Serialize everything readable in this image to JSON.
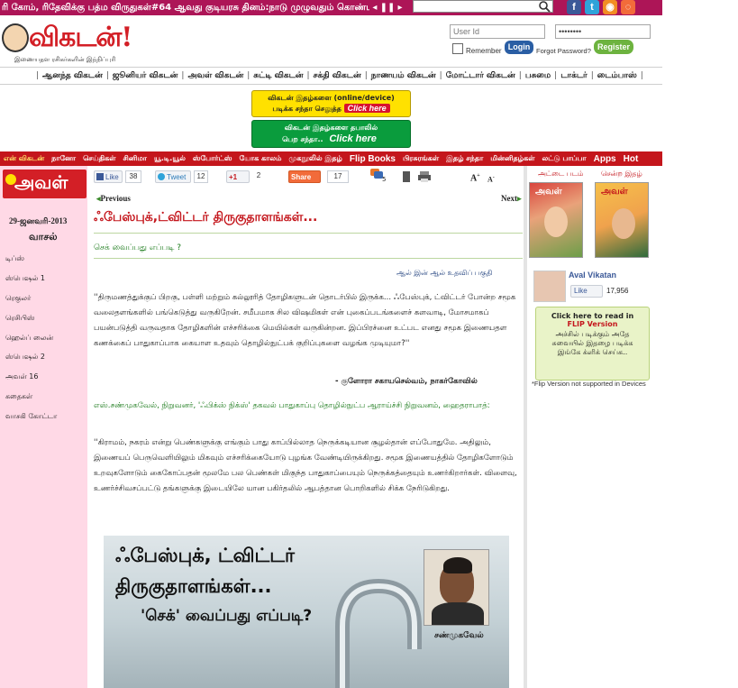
{
  "ticker": {
    "text": "ரி கோம், ரிதேவிக்கு பத்ம விருதுகள்#64 ஆவது குடியரசு தினம்:நாடு முழுவதும் கொண்டாட்டம்#",
    "controls": "◂ ❚❚ ▸"
  },
  "header": {
    "logo_text": "விகடன்!",
    "logo_tagline": "இணையதள ரசிகர்களின் இந்நிப்புரி",
    "userid_placeholder": "User Id",
    "password_value": "••••••••",
    "remember_label": "Remember",
    "login_label": "Login",
    "forgot_label": "Forgot Password?",
    "register_label": "Register"
  },
  "magazine_nav": [
    "ஆனந்த விகடன்",
    "ஜூனியர் விகடன்",
    "அவள் விகடன்",
    "சுட்டி விகடன்",
    "சக்தி விகடன்",
    "நாணயம் விகடன்",
    "மோட்டார் விகடன்",
    "பசுமை",
    "டாக்டர்",
    "டைம்பாஸ்"
  ],
  "banners": {
    "yellow_line1": "விகடன் இதழ்களை (online/device)",
    "yellow_line2": "படிக்க சந்தா செலுத்த",
    "yellow_click": "Click here",
    "green_line1": "விகடன் இதழ்களை தபாலில்",
    "green_line2": "பெற சந்தா..",
    "green_click": "Click here"
  },
  "main_nav": [
    {
      "label": "என் விகடன்",
      "style": "yellow"
    },
    {
      "label": "நானோ",
      "style": ""
    },
    {
      "label": "செய்திகள்",
      "style": ""
    },
    {
      "label": "சினிமா",
      "style": ""
    },
    {
      "label": "யூ.டி.யூல்",
      "style": ""
    },
    {
      "label": "ஸ்போர்ட்ஸ்",
      "style": ""
    },
    {
      "label": "யோக காலம்",
      "style": ""
    },
    {
      "label": "முகநூலில் இதழ்",
      "style": ""
    },
    {
      "label": "Flip Books",
      "style": "big"
    },
    {
      "label": "பிரசுரங்கள்",
      "style": ""
    },
    {
      "label": "இதழ் சந்தா",
      "style": ""
    },
    {
      "label": "மின்னிதழ்கள்",
      "style": ""
    },
    {
      "label": "லட்டு பாப்பா",
      "style": ""
    },
    {
      "label": "Apps",
      "style": "big"
    },
    {
      "label": "Hot",
      "style": "big"
    }
  ],
  "left_sidebar": {
    "logo_text": "அவள்",
    "date": "29-ஜனவரி-2013",
    "section": "வாசல்",
    "items": [
      "டிப்ஸ்",
      "ஸ்பெஷல் 1",
      "ரெகுலர்",
      "ரெசிபிஸ்",
      "ஹெல்ப் லைன்",
      "ஸ்பெஷல் 2",
      "அவள் 16",
      "கதைகள்",
      "வாசகி கோட்டா"
    ]
  },
  "share": {
    "fb_like": "Like",
    "fb_count": "38",
    "tweet": "Tweet",
    "tweet_count": "12",
    "gplus": "+1",
    "gplus_count": "2",
    "share_label": "Share",
    "share_count": "17",
    "comments_count": "5"
  },
  "article": {
    "prev": "Previous",
    "next": "Next",
    "title": "ஃபேஸ்புக்,ட்விட்டர் திருகுதாளங்கள்...",
    "subtitle": "செக் வைப்பது எப்படி ?",
    "section_label": "ஆல் இன் ஆல் உதவிப் பகுதி",
    "quote": "''திருமணத்துக்குப் பிறகு, பள்ளி மற்றும் கல்லூரித் தோழிகளுடன் தொடர்பில் இருக்க... ஃபேஸ்புக், ட்விட்டர் போன்ற சமூக வலைதளங்களில் பங்கெடுத்து வருகிறேன். சமீபமாக சில விஷமிகள் என் புகைப்படங்களைச் களவாடி, மோசமாகப் பயன்படுத்தி வருவதாக தோழிகளின் எச்சரிக்கை மெயில்கள் வருகின்றன. இப்பிரச்னை உட்பட எனது சமூக இணையதள கணக்கைப் பாதுகாப்பாக கையாள உதவும் தொழில்நுட்பக் குறிப்புகளை வழங்க முடியுமா?''",
    "quote_author": "- குளோரா சகாயசெல்வம், நாகர்கோவில்",
    "person_intro": "எஸ்.சண்முகவேல், நிறுவனர், 'ஃபிக்ஸ் நிக்ஸ்' தகவல் பாதுகாப்பு தொழில்நுட்ப ஆராய்ச்சி நிறுவனம், ஹைதராபாத்:",
    "para2": "''கிராமம், நகரம் என்று பெண்களுக்கு எங்கும் பாது காப்பில்லாத நெருக்கடியான சூழல்தான் எப்போதுமே. அதிலும், இணையப் பெருவெளியிலும் மிகவும் எச்சரிக்கையோடு புழங்க வேண்டியிருக்கிறது. சமூக இணையத்தில் தோழிகளோடும் உறவுகளோடும் கைகோப்பதன் மூலமே பல பெண்கள் மிகுந்த பாதுகாப்பையும் நெருக்கத்தையும் உணர்கிறார்கள். விளைவு, உணர்ச்சிவசப்பட்டு தங்களுக்கு இடையிலே யான பகிர்தலில் ஆபத்தான பொறிகளில் சிக்க நேரிடுகிறது.",
    "image_title1": "ஃபேஸ்புக், ட்விட்டர்",
    "image_title2": "திருகுதாளங்கள்...",
    "image_title3": "'செக்' வைப்பது எப்படி?",
    "image_person_caption": "சண்முகவேல்"
  },
  "right_col": {
    "cover_label": "அட்டை படம்",
    "current_issue_label": "சென்ற இதழ்",
    "fb_page_name": "Aval Vikatan",
    "fb_like": "Like",
    "fb_count": "17,956",
    "flip_line1": "Click here to read in",
    "flip_line2": "FLIP Version",
    "flip_line3": "அச்சில் படிக்கும் அதே",
    "flip_line4": "சுவையில் இதழை படிக்க",
    "flip_line5": "இங்கே க்ளிக் செய்க..",
    "flip_note": "*Flip Version not supported in Devices"
  },
  "colors": {
    "ticker_bg": "#ad1557",
    "nav_red": "#c4161c",
    "sidebar_pink": "#ffd9e6",
    "facebook_blue": "#3b5998"
  },
  "icons": [
    "search-icon",
    "facebook-icon",
    "twitter-icon",
    "rss-icon",
    "wifi-icon",
    "print-icon",
    "font-size-icon",
    "comment-icon"
  ]
}
